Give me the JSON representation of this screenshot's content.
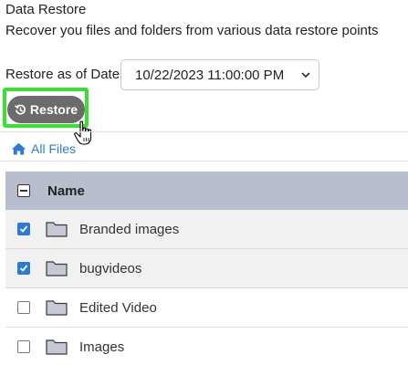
{
  "header": {
    "title": "Data Restore",
    "subtitle": "Recover you files and folders from various data restore points"
  },
  "restore": {
    "label": "Restore as of Date",
    "selected_date": "10/22/2023 11:00:00 PM",
    "button_label": "Restore",
    "highlight_color": "#39e02f",
    "button_color": "#6b6b6b"
  },
  "breadcrumb": {
    "label": "All Files",
    "icon": "home-icon",
    "color": "#2b7bd6"
  },
  "table": {
    "header_color": "#b9bece",
    "columns": [
      "Name"
    ],
    "rows": [
      {
        "name": "Branded images",
        "checked": true
      },
      {
        "name": "bugvideos",
        "checked": true
      },
      {
        "name": "Edited Video",
        "checked": false
      },
      {
        "name": "Images",
        "checked": false
      }
    ]
  }
}
